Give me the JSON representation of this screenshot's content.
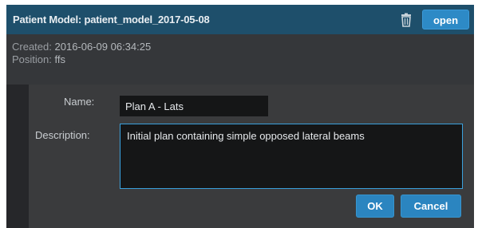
{
  "header": {
    "title": "Patient Model: patient_model_2017-05-08",
    "open_label": "open",
    "delete_icon": "trash-icon"
  },
  "info": {
    "created_label": "Created:",
    "created_value": "2016-06-09 06:34:25",
    "position_label": "Position:",
    "position_value": "ffs"
  },
  "form": {
    "name_label": "Name:",
    "name_value": "Plan A - Lats",
    "description_label": "Description:",
    "description_value": "Initial plan containing simple opposed lateral beams"
  },
  "actions": {
    "ok_label": "OK",
    "cancel_label": "Cancel"
  },
  "colors": {
    "header_bg": "#1e4f6b",
    "accent": "#2d8ac6",
    "panel_bg": "#35373a",
    "field_bg": "#151617",
    "focus_border": "#3aa0dd"
  }
}
